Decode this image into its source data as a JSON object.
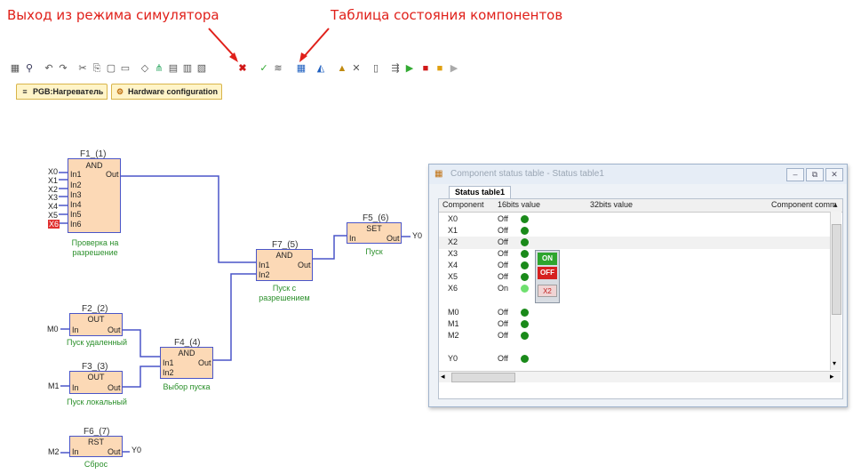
{
  "annotations": {
    "exit_sim": "Выход из режима симулятора",
    "status_table": "Таблица состояния компонентов"
  },
  "tabs": [
    {
      "label": "PGB:Нагреватель",
      "icon": "ladder-icon"
    },
    {
      "label": "Hardware configuration",
      "icon": "hardware-icon"
    }
  ],
  "blocks": {
    "f1": {
      "name": "F1_(1)",
      "type": "AND",
      "inputs": [
        "In1",
        "In2",
        "In3",
        "In4",
        "In5",
        "In6"
      ],
      "output": "Out",
      "ext_inputs": [
        "X0",
        "X1",
        "X2",
        "X3",
        "X4",
        "X5",
        "X6"
      ],
      "caption": [
        "Проверка на",
        "разрешение"
      ]
    },
    "f2": {
      "name": "F2_(2)",
      "type": "OUT",
      "input": "In",
      "output": "Out",
      "ext_input": "M0",
      "caption": [
        "Пуск удаленный"
      ]
    },
    "f3": {
      "name": "F3_(3)",
      "type": "OUT",
      "input": "In",
      "output": "Out",
      "ext_input": "M1",
      "caption": [
        "Пуск локальный"
      ]
    },
    "f4": {
      "name": "F4_(4)",
      "type": "AND",
      "inputs": [
        "In1",
        "In2"
      ],
      "output": "Out",
      "caption": [
        "Выбор пуска"
      ]
    },
    "f5": {
      "name": "F5_(6)",
      "type": "SET",
      "input": "In",
      "output": "Out",
      "ext_output": "Y0",
      "caption": [
        "Пуск"
      ]
    },
    "f6": {
      "name": "F6_(7)",
      "type": "RST",
      "input": "In",
      "output": "Out",
      "ext_input": "M2",
      "ext_output": "Y0",
      "caption": [
        "Сброс"
      ]
    },
    "f7": {
      "name": "F7_(5)",
      "type": "AND",
      "inputs": [
        "In1",
        "In2"
      ],
      "output": "Out",
      "caption": [
        "Пуск с",
        "разрешением"
      ]
    }
  },
  "status_window": {
    "title": "Component status table - Status table1",
    "tab": "Status table1",
    "columns": [
      "Component",
      "16bits value",
      "32bits value",
      "Component comm"
    ],
    "rows": [
      {
        "component": "X0",
        "value": "Off"
      },
      {
        "component": "X1",
        "value": "Off"
      },
      {
        "component": "X2",
        "value": "Off"
      },
      {
        "component": "X3",
        "value": "Off"
      },
      {
        "component": "X4",
        "value": "Off"
      },
      {
        "component": "X5",
        "value": "Off"
      },
      {
        "component": "X6",
        "value": "On"
      },
      {
        "component": "M0",
        "value": "Off"
      },
      {
        "component": "M1",
        "value": "Off"
      },
      {
        "component": "M2",
        "value": "Off"
      },
      {
        "component": "Y0",
        "value": "Off"
      }
    ],
    "popup": {
      "on": "ON",
      "off": "OFF",
      "target": "X2"
    },
    "colors": {
      "led_green": "#1a8a1a",
      "on": "#2ea52e",
      "off": "#d62020"
    }
  }
}
